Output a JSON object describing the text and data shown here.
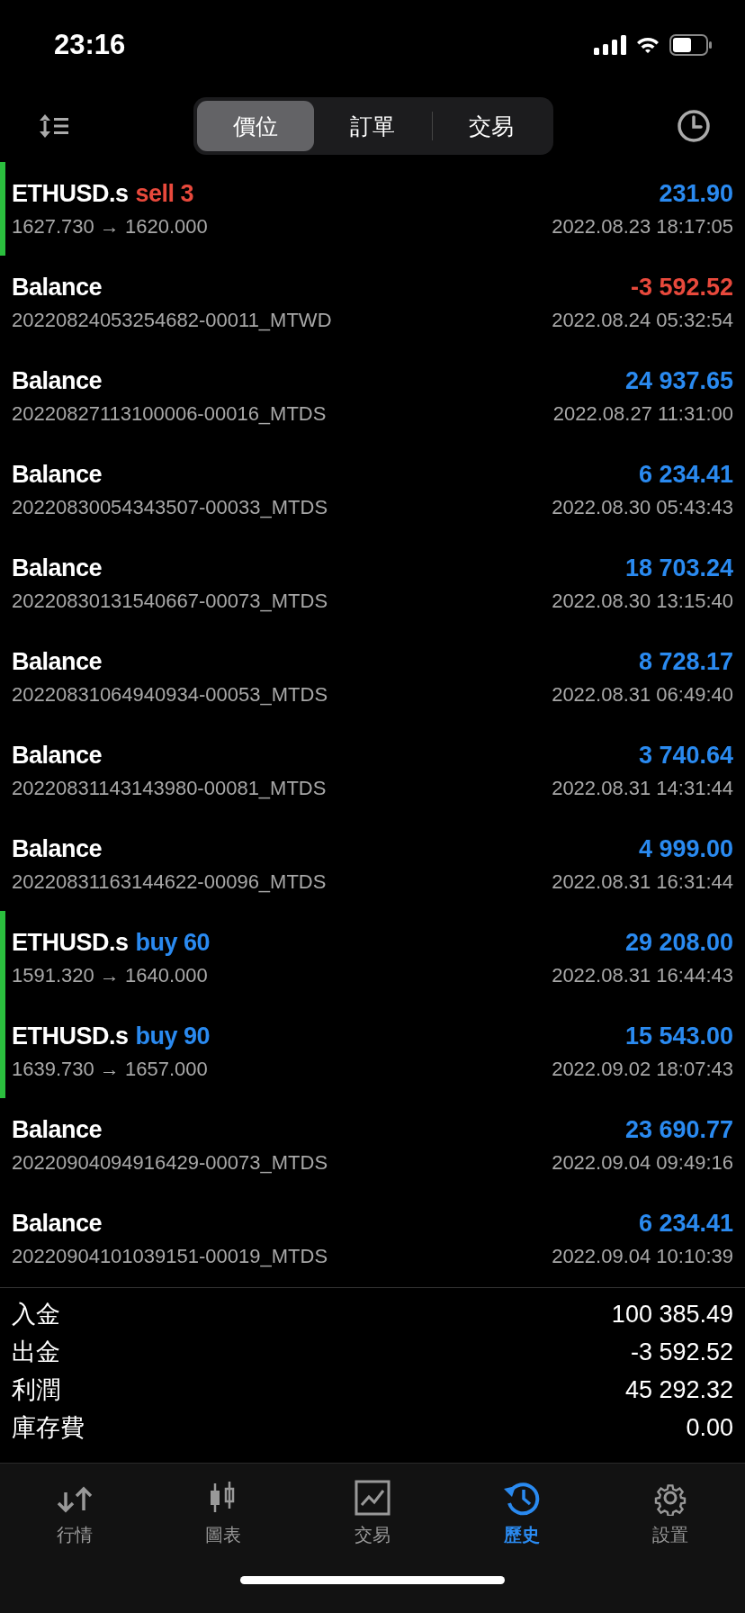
{
  "status_bar": {
    "time": "23:16"
  },
  "segments": [
    {
      "label": "價位",
      "selected": true
    },
    {
      "label": "訂單",
      "selected": false
    },
    {
      "label": "交易",
      "selected": false
    }
  ],
  "rows": [
    {
      "kind": "sell",
      "symbol": "ETHUSD.s",
      "order": "sell 3",
      "detail": "1627.730 → 1620.000",
      "amount": "231.90",
      "negative": false,
      "time": "2022.08.23 18:17:05"
    },
    {
      "kind": "balance",
      "symbol": "Balance",
      "detail": "20220824053254682-00011_MTWD",
      "amount": "-3 592.52",
      "negative": true,
      "time": "2022.08.24 05:32:54"
    },
    {
      "kind": "balance",
      "symbol": "Balance",
      "detail": "20220827113100006-00016_MTDS",
      "amount": "24 937.65",
      "negative": false,
      "time": "2022.08.27 11:31:00"
    },
    {
      "kind": "balance",
      "symbol": "Balance",
      "detail": "20220830054343507-00033_MTDS",
      "amount": "6 234.41",
      "negative": false,
      "time": "2022.08.30 05:43:43"
    },
    {
      "kind": "balance",
      "symbol": "Balance",
      "detail": "20220830131540667-00073_MTDS",
      "amount": "18 703.24",
      "negative": false,
      "time": "2022.08.30 13:15:40"
    },
    {
      "kind": "balance",
      "symbol": "Balance",
      "detail": "20220831064940934-00053_MTDS",
      "amount": "8 728.17",
      "negative": false,
      "time": "2022.08.31 06:49:40"
    },
    {
      "kind": "balance",
      "symbol": "Balance",
      "detail": "20220831143143980-00081_MTDS",
      "amount": "3 740.64",
      "negative": false,
      "time": "2022.08.31 14:31:44"
    },
    {
      "kind": "balance",
      "symbol": "Balance",
      "detail": "20220831163144622-00096_MTDS",
      "amount": "4 999.00",
      "negative": false,
      "time": "2022.08.31 16:31:44"
    },
    {
      "kind": "buy",
      "symbol": "ETHUSD.s",
      "order": "buy 60",
      "detail": "1591.320 → 1640.000",
      "amount": "29 208.00",
      "negative": false,
      "time": "2022.08.31 16:44:43"
    },
    {
      "kind": "buy",
      "symbol": "ETHUSD.s",
      "order": "buy 90",
      "detail": "1639.730 → 1657.000",
      "amount": "15 543.00",
      "negative": false,
      "time": "2022.09.02 18:07:43"
    },
    {
      "kind": "balance",
      "symbol": "Balance",
      "detail": "20220904094916429-00073_MTDS",
      "amount": "23 690.77",
      "negative": false,
      "time": "2022.09.04 09:49:16"
    },
    {
      "kind": "balance",
      "symbol": "Balance",
      "detail": "20220904101039151-00019_MTDS",
      "amount": "6 234.41",
      "negative": false,
      "time": "2022.09.04 10:10:39"
    }
  ],
  "summary": [
    {
      "label": "入金",
      "value": "100 385.49"
    },
    {
      "label": "出金",
      "value": "-3 592.52"
    },
    {
      "label": "利潤",
      "value": "45 292.32"
    },
    {
      "label": "庫存費",
      "value": "0.00"
    }
  ],
  "tab_bar": [
    {
      "label": "行情",
      "selected": false
    },
    {
      "label": "圖表",
      "selected": false
    },
    {
      "label": "交易",
      "selected": false
    },
    {
      "label": "歷史",
      "selected": true
    },
    {
      "label": "設置",
      "selected": false
    }
  ]
}
